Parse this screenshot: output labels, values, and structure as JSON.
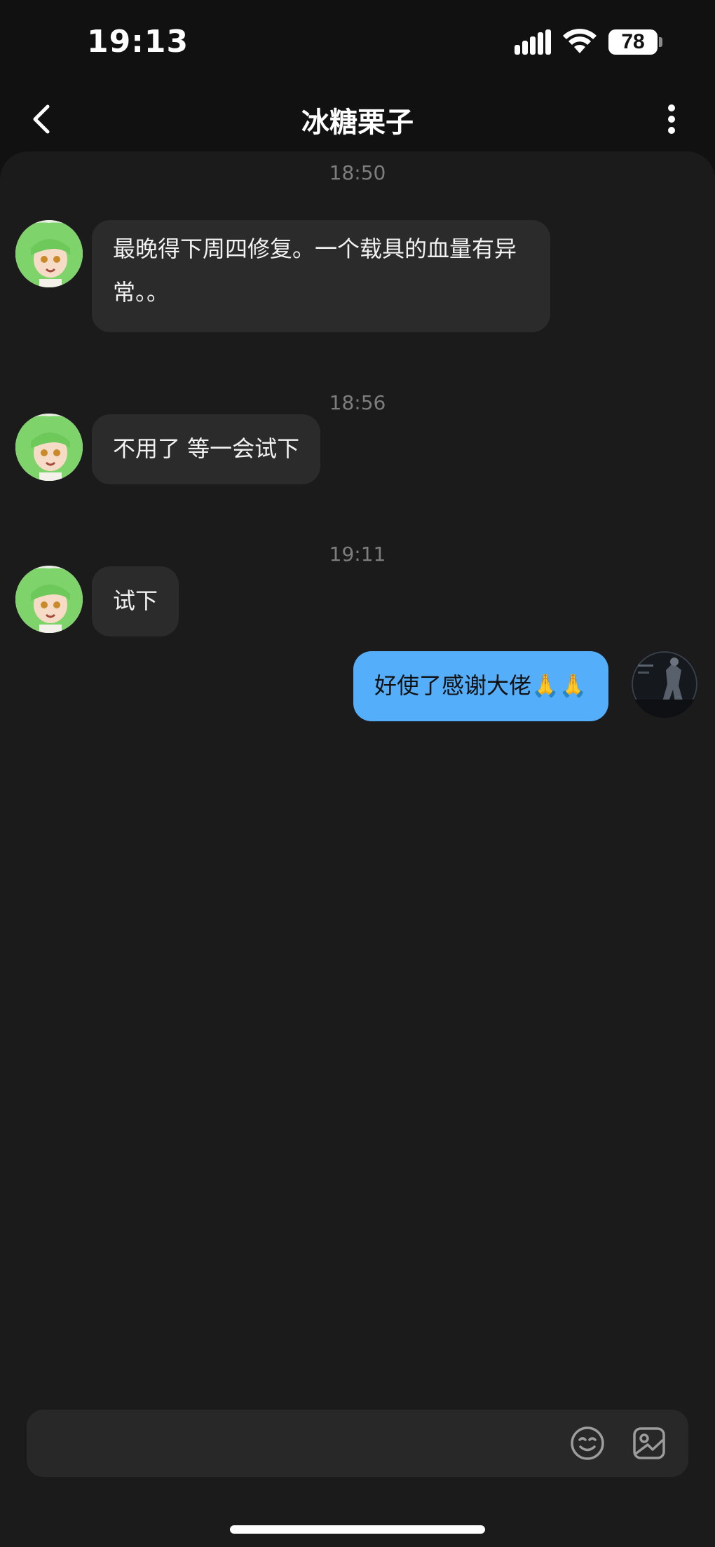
{
  "status_bar": {
    "time": "19:13",
    "battery": "78",
    "icons": [
      "signal-icon",
      "wifi-icon",
      "battery-icon"
    ]
  },
  "header": {
    "title": "冰糖栗子",
    "back_icon": "chevron-left-icon",
    "more_icon": "more-vertical-icon"
  },
  "messages": [
    {
      "time": "18:50",
      "direction": "incoming",
      "lines": [
        "最晚得下周四修复。一个载具的血量有异",
        "常。。"
      ]
    },
    {
      "time": "18:56",
      "direction": "incoming",
      "text": "不用了 等一会试下"
    },
    {
      "time": "19:11",
      "direction": "incoming",
      "text": "试下"
    },
    {
      "direction": "outgoing",
      "text": "好使了感谢大佬🙏🙏"
    }
  ],
  "input_bar": {
    "placeholder": "",
    "icons": [
      "emoji-icon",
      "sticker-icon"
    ]
  },
  "colors": {
    "background": "#111111",
    "panel": "#1b1b1b",
    "incoming_bubble": "#2b2b2b",
    "outgoing_bubble": "#54aef9",
    "timestamp": "#7d7d7d"
  }
}
